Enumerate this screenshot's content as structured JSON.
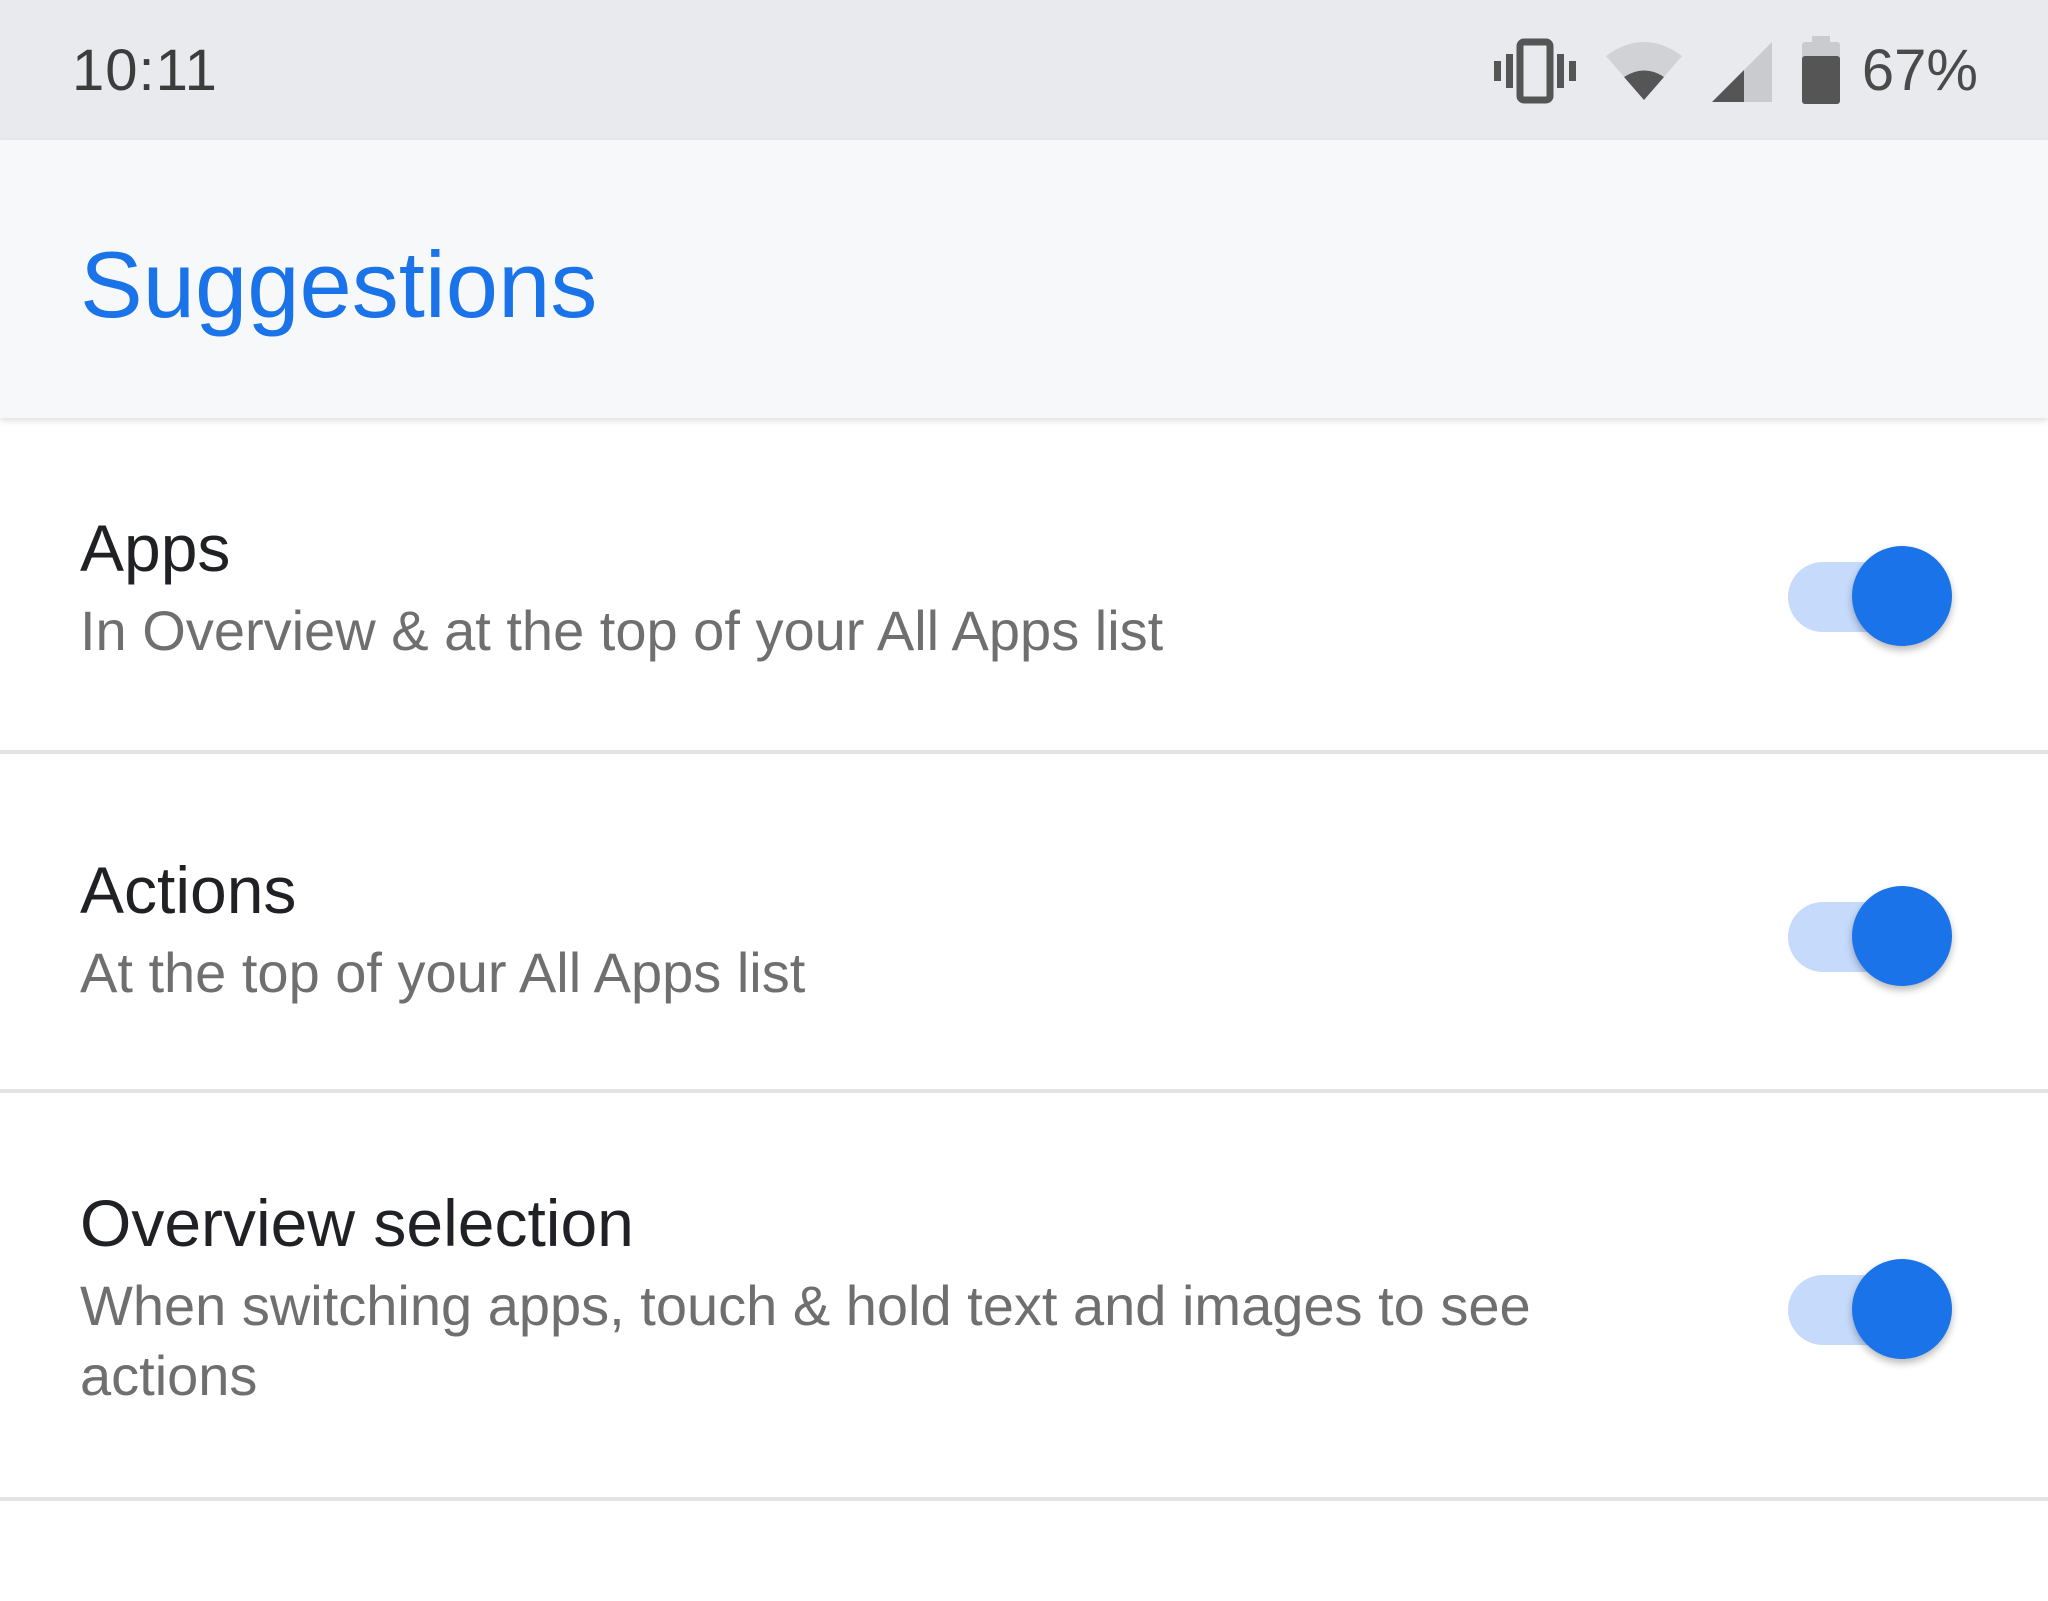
{
  "status_bar": {
    "time": "10:11",
    "battery_percent": "67%",
    "icons": [
      "vibrate-icon",
      "wifi-icon",
      "cell-signal-icon",
      "battery-icon"
    ]
  },
  "app_bar": {
    "title": "Suggestions"
  },
  "colors": {
    "accent": "#1a73e8",
    "toggle_track_on": "#c6dafc",
    "status_bar_bg": "#e9eaee",
    "app_bar_bg": "#f7f8fa"
  },
  "settings": [
    {
      "title": "Apps",
      "summary": "In Overview & at the top of your All Apps list",
      "enabled": true
    },
    {
      "title": "Actions",
      "summary": "At the top of your All Apps list",
      "enabled": true
    },
    {
      "title": "Overview selection",
      "summary": "When switching apps, touch & hold text and images to see actions",
      "enabled": true
    }
  ]
}
